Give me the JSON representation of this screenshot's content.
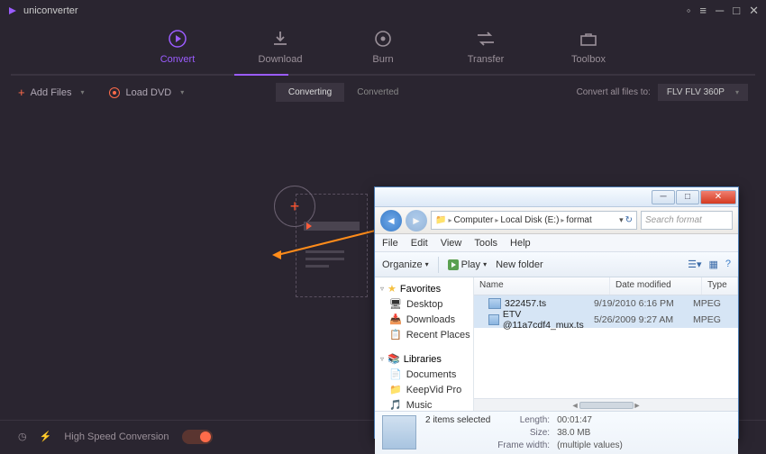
{
  "app": {
    "title": "uniconverter"
  },
  "nav": {
    "items": [
      {
        "label": "Convert",
        "active": true
      },
      {
        "label": "Download"
      },
      {
        "label": "Burn"
      },
      {
        "label": "Transfer"
      },
      {
        "label": "Toolbox"
      }
    ]
  },
  "toolbar": {
    "add_files": "Add Files",
    "load_dvd": "Load DVD",
    "tab_converting": "Converting",
    "tab_converted": "Converted",
    "convert_all_label": "Convert all files to:",
    "format_value": "FLV FLV 360P"
  },
  "footer": {
    "hsc_label": "High Speed Conversion"
  },
  "explorer": {
    "breadcrumb": [
      "Computer",
      "Local Disk (E:)",
      "format"
    ],
    "search_placeholder": "Search format",
    "menu": [
      "File",
      "Edit",
      "View",
      "Tools",
      "Help"
    ],
    "tools": {
      "organize": "Organize",
      "play": "Play",
      "newfolder": "New folder"
    },
    "sidebar": {
      "favorites": "Favorites",
      "fav_items": [
        "Desktop",
        "Downloads",
        "Recent Places"
      ],
      "libraries": "Libraries",
      "lib_items": [
        "Documents",
        "KeepVid Pro",
        "Music"
      ]
    },
    "columns": {
      "name": "Name",
      "date": "Date modified",
      "type": "Type"
    },
    "files": [
      {
        "name": "322457.ts",
        "date": "9/19/2010 6:16 PM",
        "type": "MPEG"
      },
      {
        "name": "ETV @11a7cdf4_mux.ts",
        "date": "5/26/2009 9:27 AM",
        "type": "MPEG"
      }
    ],
    "status": {
      "selected": "2 items selected",
      "length_k": "Length:",
      "length_v": "00:01:47",
      "size_k": "Size:",
      "size_v": "38.0 MB",
      "fw_k": "Frame width:",
      "fw_v": "(multiple values)"
    }
  }
}
